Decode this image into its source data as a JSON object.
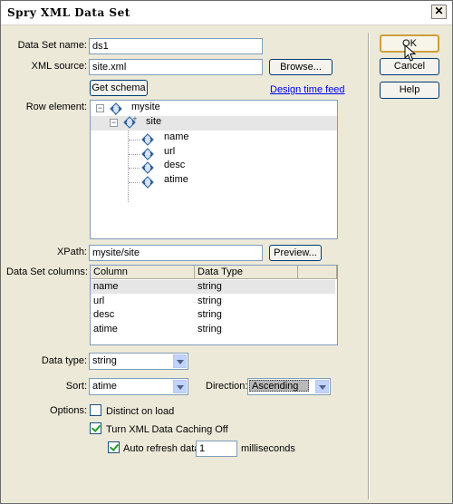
{
  "window": {
    "title": "Spry XML Data Set"
  },
  "buttons": {
    "ok": "OK",
    "cancel": "Cancel",
    "help": "Help",
    "browse": "Browse...",
    "get_schema": "Get schema",
    "preview": "Preview..."
  },
  "links": {
    "design_time_feed": "Design time feed"
  },
  "labels": {
    "data_set_name": "Data Set name:",
    "xml_source": "XML source:",
    "row_element": "Row element:",
    "xpath": "XPath:",
    "data_set_columns": "Data Set columns:",
    "data_type": "Data type:",
    "sort": "Sort:",
    "direction": "Direction:",
    "options": "Options:"
  },
  "fields": {
    "data_set_name": "ds1",
    "xml_source": "site.xml",
    "xpath": "mysite/site",
    "data_type": "string",
    "sort": "atime",
    "direction": "Ascending",
    "auto_refresh": "1"
  },
  "tree": {
    "root": "mysite",
    "row": "site",
    "children": [
      "name",
      "url",
      "desc",
      "atime"
    ]
  },
  "columns": {
    "headers": [
      "Column",
      "Data Type"
    ],
    "rows": [
      [
        "name",
        "string"
      ],
      [
        "url",
        "string"
      ],
      [
        "desc",
        "string"
      ],
      [
        "atime",
        "string"
      ]
    ]
  },
  "options": {
    "distinct_on_load": {
      "label": "Distinct on load",
      "checked": false
    },
    "turn_caching_off": {
      "label": "Turn XML Data Caching Off",
      "checked": true
    },
    "auto_refresh": {
      "label": "Auto refresh data",
      "checked": true,
      "unit": "milliseconds"
    }
  },
  "colors": {
    "link": "#0000ee",
    "dialog_bg": "#ece9d8",
    "field_border": "#7f9db9",
    "default_button_border": "#cf9f3c"
  }
}
